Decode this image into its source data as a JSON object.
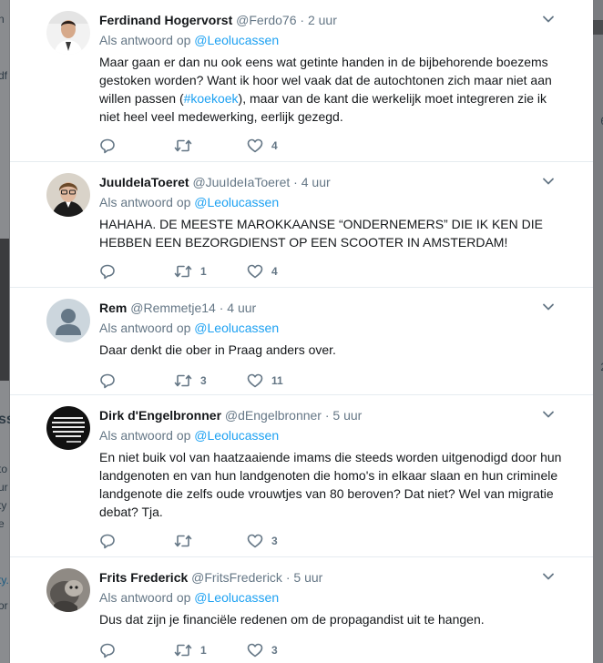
{
  "replies_label": "Als antwoord op",
  "tweets": [
    {
      "name": "Ferdinand Hogervorst",
      "handle": "@Ferdo76",
      "time": "2 uur",
      "reply_to": "@Leolucassen",
      "text_a": "Maar gaan er dan nu ook eens wat getinte handen in de bijbehorende boezems gestoken worden? Want ik hoor wel vaak dat de autochtonen zich maar niet aan willen passen (",
      "hashtag": "#koekoek",
      "text_b": "), maar van de kant die werkelijk moet integreren zie ik niet heel veel medewerking, eerlijk gezegd.",
      "replies": "",
      "retweets": "",
      "likes": "4"
    },
    {
      "name": "JuuIdeIaToeret",
      "handle": "@JuuIdeIaToeret",
      "time": "4 uur",
      "reply_to": "@Leolucassen",
      "text": "HAHAHA. DE MEESTE MAROKKAANSE “ONDERNEMERS” DIE IK KEN DIE HEBBEN EEN BEZORGDIENST OP EEN SCOOTER IN AMSTERDAM!",
      "replies": "",
      "retweets": "1",
      "likes": "4"
    },
    {
      "name": "Rem",
      "handle": "@Remmetje14",
      "time": "4 uur",
      "reply_to": "@Leolucassen",
      "text": "Daar denkt die ober in Praag anders over.",
      "replies": "",
      "retweets": "3",
      "likes": "11"
    },
    {
      "name": "Dirk d'Engelbronner",
      "handle": "@dEngelbronner",
      "time": "5 uur",
      "reply_to": "@Leolucassen",
      "text": "En niet buik vol van haatzaaiende imams die steeds worden uitgenodigd door hun landgenoten en van hun landgenoten die homo's in elkaar slaan en hun criminele landgenote die zelfs oude vrouwtjes van 80 beroven? Dat niet? Wel van migratie debat? Tja.",
      "replies": "",
      "retweets": "",
      "likes": "3"
    },
    {
      "name": "Frits Frederick",
      "handle": "@FritsFrederick",
      "time": "5 uur",
      "reply_to": "@Leolucassen",
      "text": "Dus dat zijn je financiële redenen om de propagandist uit te hangen.",
      "replies": "",
      "retweets": "1",
      "likes": "3"
    }
  ],
  "background": {
    "left_snippets": [
      "n",
      "df",
      "ss",
      "to",
      "ur",
      "ty",
      "e",
      "ty.",
      "or"
    ],
    "right_snippets": [
      "6",
      "2"
    ]
  },
  "colors": {
    "accent": "#1da1f2",
    "text": "#14171a",
    "muted": "#657786",
    "border": "#e6ecf0"
  },
  "icons": [
    "reply-icon",
    "retweet-icon",
    "like-icon",
    "chevron-down-icon",
    "default-avatar-icon"
  ]
}
